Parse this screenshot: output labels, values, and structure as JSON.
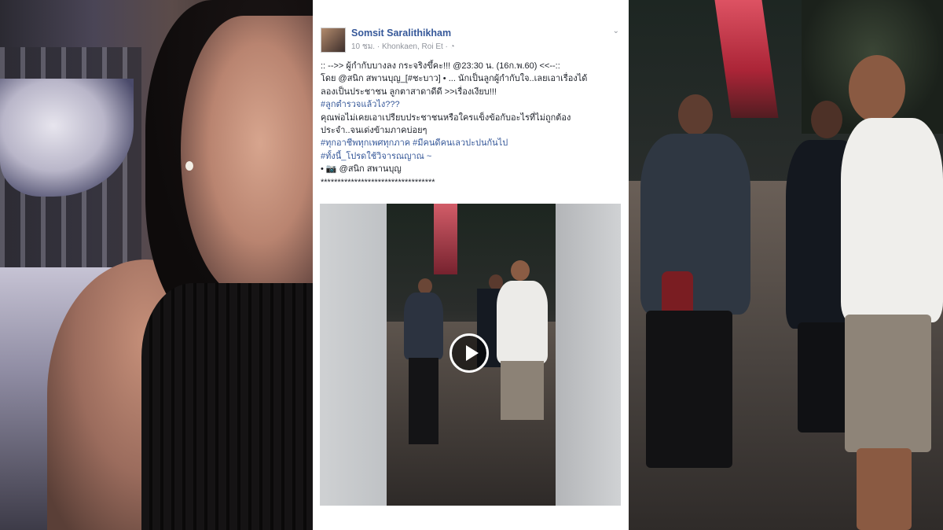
{
  "post": {
    "author": "Somsit Saralithikham",
    "meta": "10 ชม. · Khonkaen, Roi Et · ◔",
    "menu_icon": "chevron-down-icon",
    "lines": [
      ":: -->> ผู้กำกับบางลง กระจริงขึ้คะ!!! @23:30 น. (16ก.พ.60) <<--::",
      "โดย @สนิก สพานบุญ_[#ชะบาว] • ... นักเป็นลูกผู้กำกับใจ..เลยเอาเรื่องได้",
      "ลองเป็นประชาชน ลูกตาสาดาดีดี >>เรื่องเงียบ!!!",
      "#ลูกตำรวจแล้วไง???",
      "คุณพ่อไม่เคยเอาเปรียบประชาชนหรือใครแข็งข้อกับอะไรที่ไม่ถูกต้อง",
      "ประจำ..จนเด่งข้ามภาคบ่อยๆ",
      "#ทุกอาชีพทุกเพศทุกภาค #มีคนดีคนเลวปะปนกันไป",
      "#ทั้งนี้_โปรดใช้วิจารณญาณ ~",
      "• 📷 @สนิก สพานบุญ",
      "**********************************"
    ]
  },
  "video": {
    "play_icon": "play-icon"
  }
}
